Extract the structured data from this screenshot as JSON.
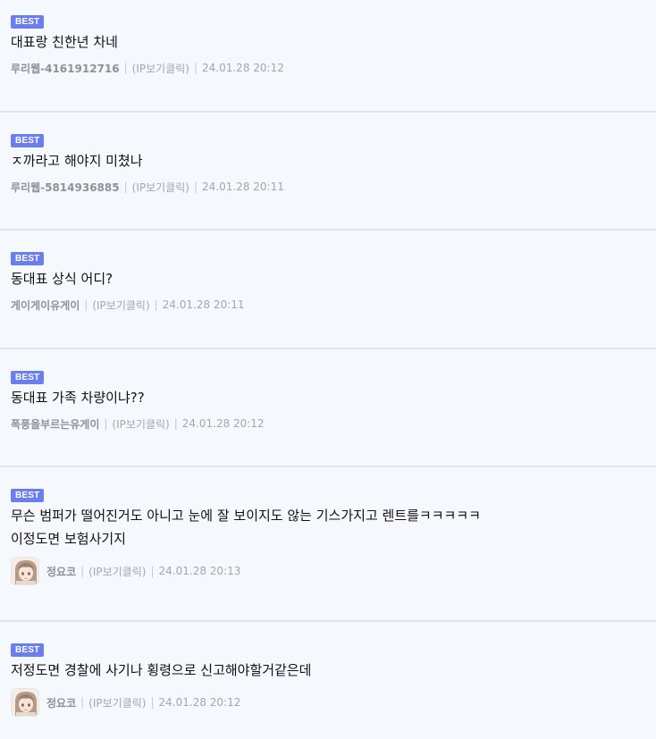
{
  "comments": [
    {
      "badge": "BEST",
      "text": "대표랑 친한년 차네",
      "nickname": "루리웹-4161912716",
      "ip_label": "(IP보기클릭)",
      "datetime": "24.01.28 20:12",
      "avatar": null
    },
    {
      "badge": "BEST",
      "text": "ㅈ까라고 해야지 미쳤나",
      "nickname": "루리웹-5814936885",
      "ip_label": "(IP보기클릭)",
      "datetime": "24.01.28 20:11",
      "avatar": null
    },
    {
      "badge": "BEST",
      "text": "동대표 상식 어디?",
      "nickname": "게이게이유게이",
      "ip_label": "(IP보기클릭)",
      "datetime": "24.01.28 20:11",
      "avatar": null
    },
    {
      "badge": "BEST",
      "text": "동대표 가족 차량이냐??",
      "nickname": "폭풍을부르는유게이",
      "ip_label": "(IP보기클릭)",
      "datetime": "24.01.28 20:12",
      "avatar": null
    },
    {
      "badge": "BEST",
      "text": "무슨 범퍼가 떨어진거도 아니고 눈에 잘 보이지도 않는 기스가지고 렌트를ㅋㅋㅋㅋㅋ\n이정도면 보험사기지",
      "nickname": "정요코",
      "ip_label": "(IP보기클릭)",
      "datetime": "24.01.28 20:13",
      "avatar": "anime-girl-avatar"
    },
    {
      "badge": "BEST",
      "text": "저정도면 경찰에 사기나 횡령으로 신고해야할거같은데",
      "nickname": "정요코",
      "ip_label": "(IP보기클릭)",
      "datetime": "24.01.28 20:12",
      "avatar": "anime-girl-avatar"
    }
  ],
  "colors": {
    "badge": "#6b7ef0",
    "background": "#f5f8fd",
    "divider": "#dfe3ea",
    "meta_text": "#a3a7ad",
    "nickname": "#8e9298"
  }
}
